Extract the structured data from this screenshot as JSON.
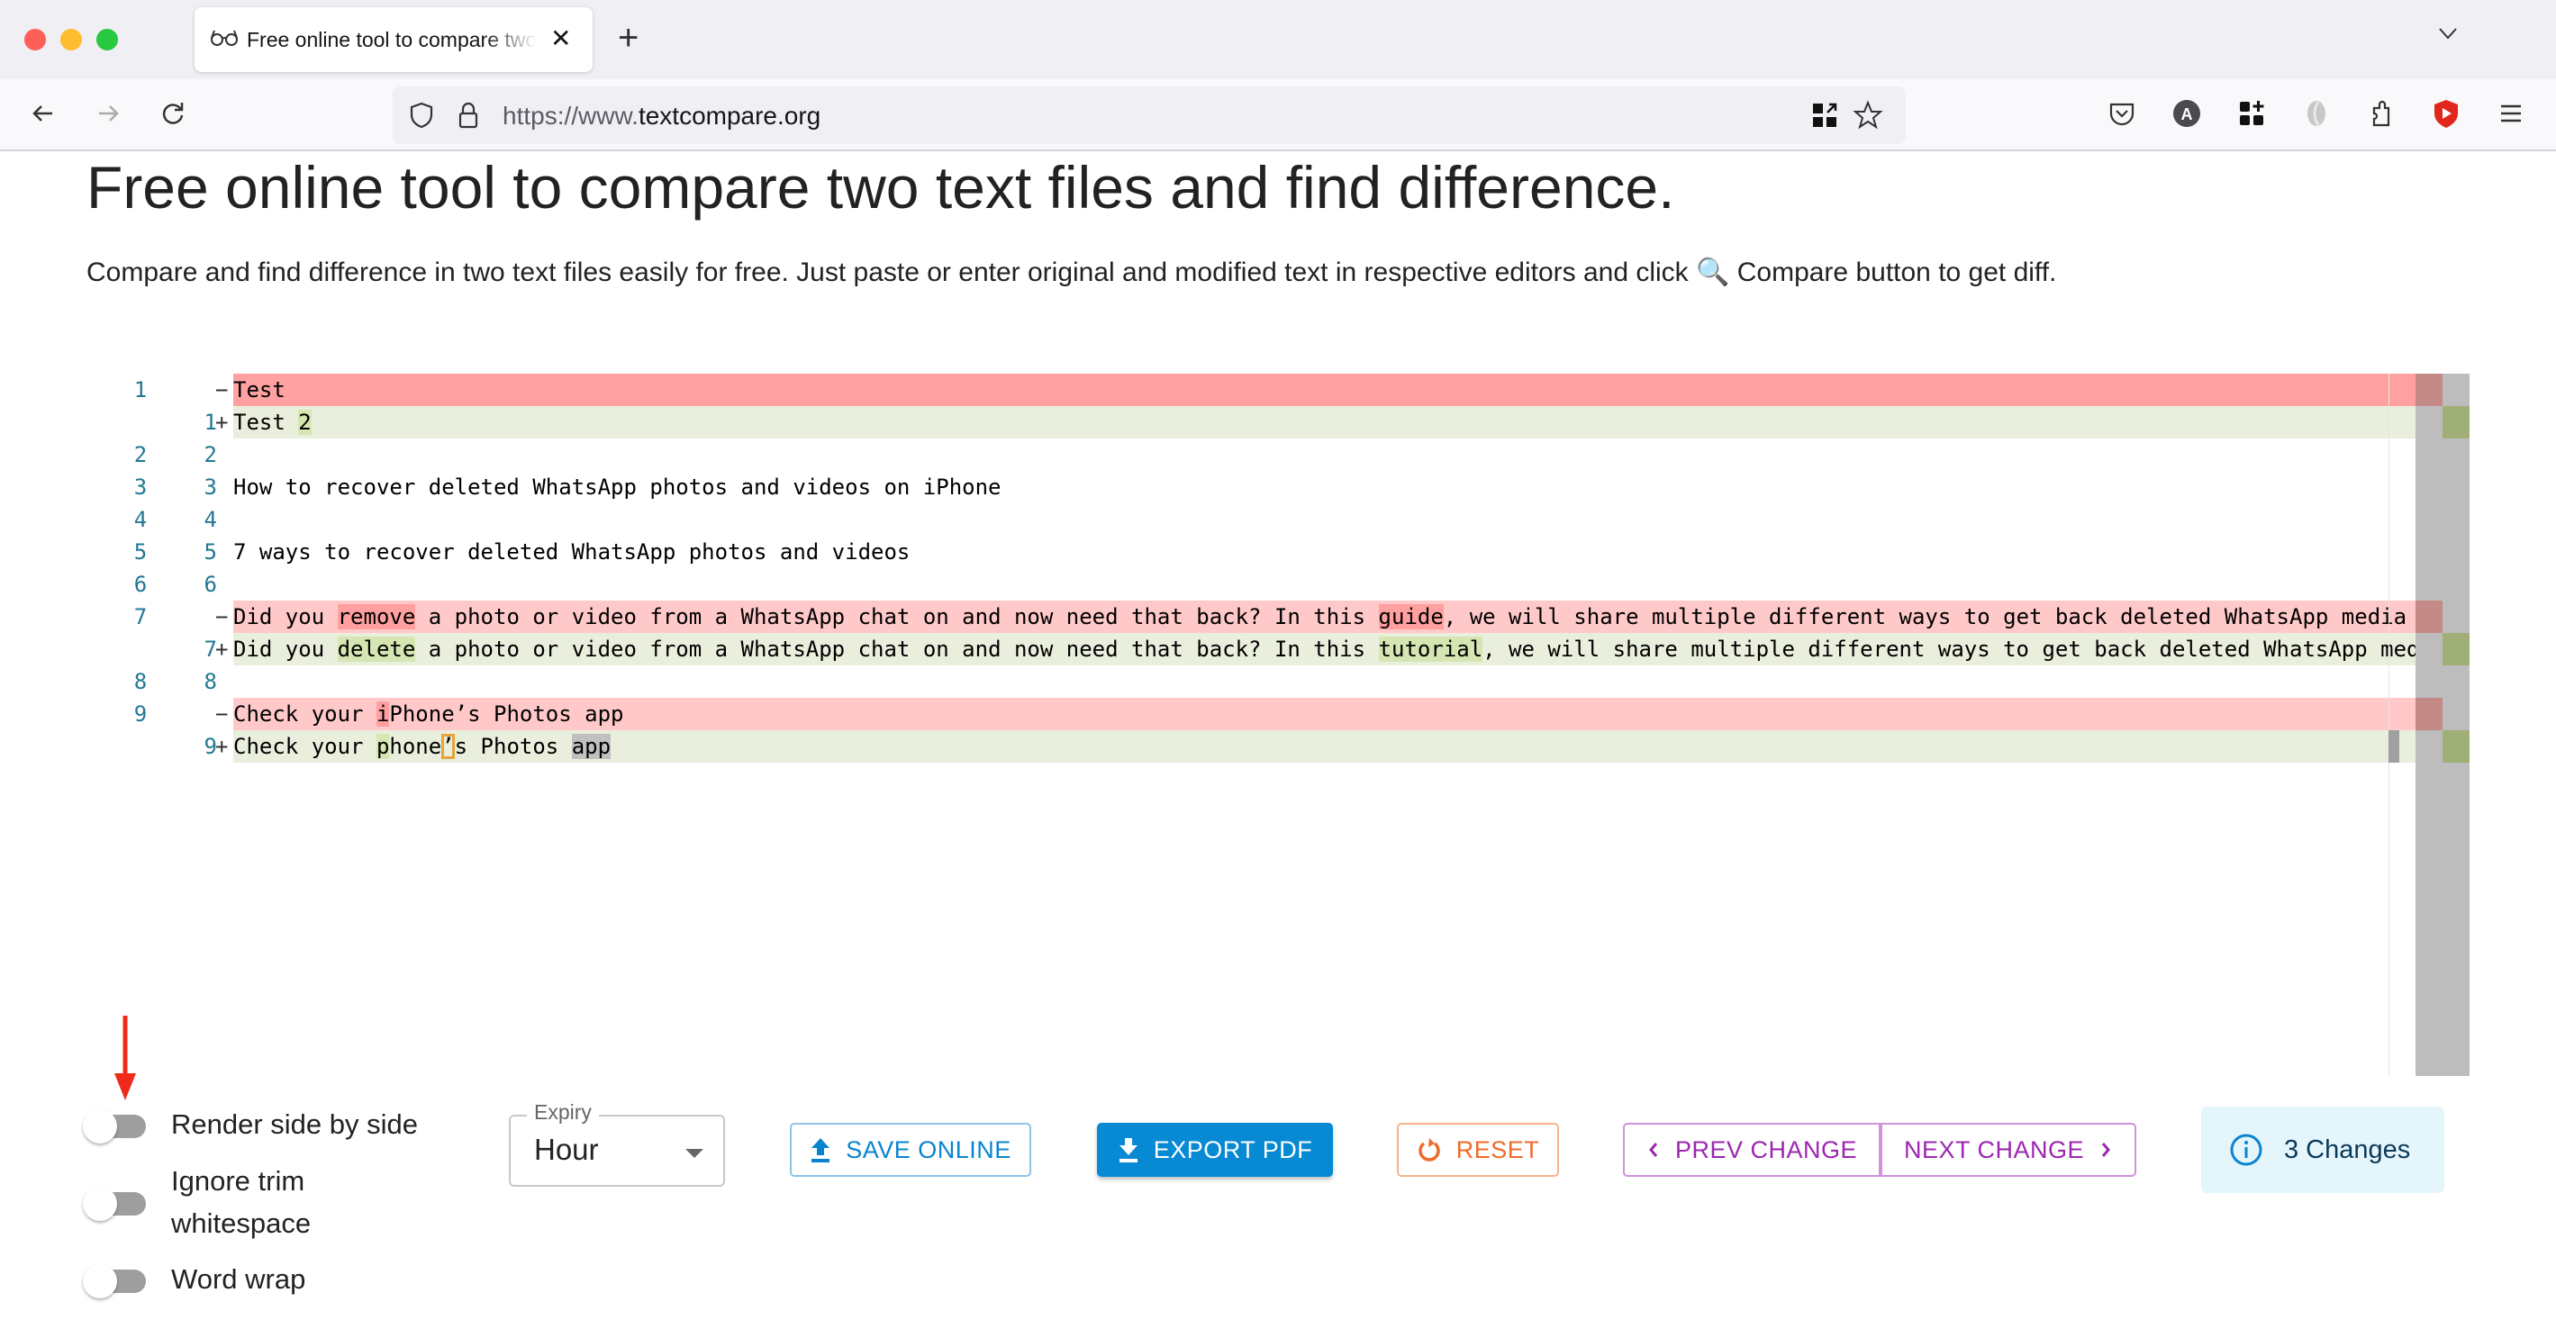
{
  "browser": {
    "tab_title": "Free online tool to compare two text files and find difference.",
    "tab_icon": "glasses-icon",
    "new_tab_label": "+",
    "url_prefix": "https://www.",
    "url_domain": "textcompare.org",
    "toolbar_icons": [
      "back-icon",
      "forward-icon",
      "reload-icon",
      "shield-icon",
      "lock-icon",
      "qr-code-icon",
      "bookmark-star-icon",
      "pocket-icon",
      "account-avatar-icon",
      "extensions-grid-icon",
      "extension-gray-icon",
      "puzzle-icon",
      "brave-shield-icon",
      "menu-icon"
    ],
    "avatar_letter": "A"
  },
  "page": {
    "title": "Free online tool to compare two text files and find difference.",
    "description_before": "Compare and find difference in two text files easily for free. Just paste or enter original and modified text in respective editors and click ",
    "description_icon": "🔍",
    "description_after": " Compare button to get diff."
  },
  "diff": {
    "rows": [
      {
        "type": "del",
        "strong": true,
        "old": "1",
        "new": "",
        "marker": "−",
        "segments": [
          {
            "t": "Test"
          }
        ]
      },
      {
        "type": "ins",
        "old": "",
        "new": "1",
        "marker": "+",
        "segments": [
          {
            "t": "Test "
          },
          {
            "t": "2",
            "hl": "ins"
          }
        ]
      },
      {
        "type": "ctx",
        "old": "2",
        "new": "2",
        "marker": "",
        "segments": [
          {
            "t": ""
          }
        ]
      },
      {
        "type": "ctx",
        "old": "3",
        "new": "3",
        "marker": "",
        "segments": [
          {
            "t": "How to recover deleted WhatsApp photos and videos on iPhone"
          }
        ]
      },
      {
        "type": "ctx",
        "old": "4",
        "new": "4",
        "marker": "",
        "segments": [
          {
            "t": ""
          }
        ]
      },
      {
        "type": "ctx",
        "old": "5",
        "new": "5",
        "marker": "",
        "segments": [
          {
            "t": "7 ways to recover deleted WhatsApp photos and videos"
          }
        ]
      },
      {
        "type": "ctx",
        "old": "6",
        "new": "6",
        "marker": "",
        "segments": [
          {
            "t": ""
          }
        ]
      },
      {
        "type": "del",
        "old": "7",
        "new": "",
        "marker": "−",
        "segments": [
          {
            "t": "Did you "
          },
          {
            "t": "remove",
            "hl": "del"
          },
          {
            "t": " a photo or video from a WhatsApp chat on and now need that back? In this "
          },
          {
            "t": "guide",
            "hl": "del"
          },
          {
            "t": ", we will share multiple different ways to get back deleted WhatsApp media"
          }
        ]
      },
      {
        "type": "ins",
        "old": "",
        "new": "7",
        "marker": "+",
        "segments": [
          {
            "t": "Did you "
          },
          {
            "t": "delete",
            "hl": "ins"
          },
          {
            "t": " a photo or video from a WhatsApp chat on and now need that back? In this "
          },
          {
            "t": "tutorial",
            "hl": "ins"
          },
          {
            "t": ", we will share multiple different ways to get back deleted WhatsApp media"
          }
        ]
      },
      {
        "type": "ctx",
        "old": "8",
        "new": "8",
        "marker": "",
        "segments": [
          {
            "t": ""
          }
        ]
      },
      {
        "type": "del",
        "old": "9",
        "new": "",
        "marker": "−",
        "segments": [
          {
            "t": "Check your "
          },
          {
            "t": "i",
            "hl": "del"
          },
          {
            "t": "Phone’s Photos app"
          }
        ]
      },
      {
        "type": "ins",
        "old": "",
        "new": "9",
        "marker": "+",
        "segments": [
          {
            "t": "Check your "
          },
          {
            "t": "p",
            "hl": "ins"
          },
          {
            "t": "hone"
          },
          {
            "t": "’",
            "hl": "box"
          },
          {
            "t": "s Photos "
          },
          {
            "t": "app",
            "hl": "sel"
          }
        ]
      }
    ]
  },
  "controls": {
    "toggles": [
      {
        "label": "Render side by side",
        "checked": false
      },
      {
        "label": "Ignore trim whitespace",
        "label_line1": "Ignore trim",
        "label_line2": "whitespace",
        "checked": false
      },
      {
        "label": "Word wrap",
        "checked": false
      }
    ],
    "expiry": {
      "label": "Expiry",
      "value": "Hour"
    },
    "buttons": {
      "save_online": "SAVE ONLINE",
      "export_pdf": "EXPORT PDF",
      "reset": "RESET",
      "prev_change": "PREV CHANGE",
      "next_change": "NEXT CHANGE"
    },
    "changes_count": "3 Changes"
  },
  "colors": {
    "deleted_line": "#ffc9c9",
    "deleted_word": "#ff9f9f",
    "inserted_line": "#e9efdc",
    "inserted_word": "#d5e6b2",
    "primary": "#0789d4",
    "reset": "#ef6a2c",
    "nav": "#9c27b0",
    "annotation_arrow": "#f02a1a"
  }
}
